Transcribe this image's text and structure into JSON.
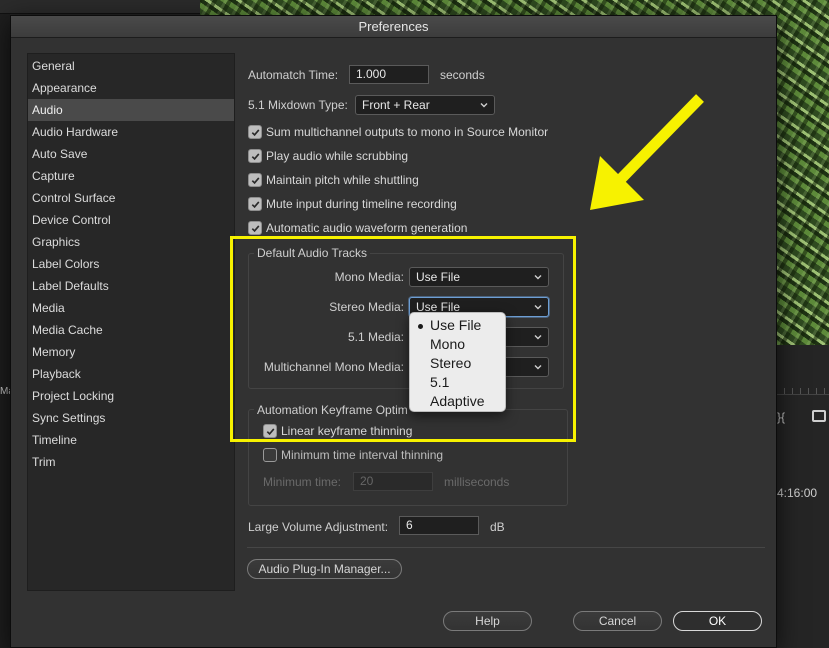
{
  "dialog": {
    "title": "Preferences"
  },
  "sidebar": {
    "items": [
      {
        "label": "General"
      },
      {
        "label": "Appearance"
      },
      {
        "label": "Audio",
        "selected": true
      },
      {
        "label": "Audio Hardware"
      },
      {
        "label": "Auto Save"
      },
      {
        "label": "Capture"
      },
      {
        "label": "Control Surface"
      },
      {
        "label": "Device Control"
      },
      {
        "label": "Graphics"
      },
      {
        "label": "Label Colors"
      },
      {
        "label": "Label Defaults"
      },
      {
        "label": "Media"
      },
      {
        "label": "Media Cache"
      },
      {
        "label": "Memory"
      },
      {
        "label": "Playback"
      },
      {
        "label": "Project Locking"
      },
      {
        "label": "Sync Settings"
      },
      {
        "label": "Timeline"
      },
      {
        "label": "Trim"
      }
    ]
  },
  "audio": {
    "automatch_label": "Automatch Time:",
    "automatch_value": "1.000",
    "automatch_unit": "seconds",
    "mixdown_label": "5.1 Mixdown Type:",
    "mixdown_value": "Front + Rear",
    "checkboxes": [
      {
        "label": "Sum multichannel outputs to mono in Source Monitor",
        "checked": true
      },
      {
        "label": "Play audio while scrubbing",
        "checked": true
      },
      {
        "label": "Maintain pitch while shuttling",
        "checked": true
      },
      {
        "label": "Mute input during timeline recording",
        "checked": true
      },
      {
        "label": "Automatic audio waveform generation",
        "checked": true
      }
    ]
  },
  "default_tracks": {
    "title": "Default Audio Tracks",
    "mono_label": "Mono Media:",
    "mono_value": "Use File",
    "stereo_label": "Stereo Media:",
    "stereo_value": "Use File",
    "fiveone_label": "5.1 Media:",
    "multichannel_label": "Multichannel Mono Media:"
  },
  "dropdown": {
    "options": [
      "Use File",
      "Mono",
      "Stereo",
      "5.1",
      "Adaptive"
    ],
    "selected": "Use File"
  },
  "keyframe": {
    "title": "Automation Keyframe Optim",
    "linear_label": "Linear keyframe thinning",
    "linear_checked": true,
    "min_interval_label": "Minimum time interval thinning",
    "min_interval_checked": false,
    "min_time_label": "Minimum time:",
    "min_time_value": "20",
    "min_time_unit": "milliseconds"
  },
  "volume": {
    "label": "Large Volume Adjustment:",
    "value": "6",
    "unit": "dB"
  },
  "buttons": {
    "plugin_manager": "Audio Plug-In Manager...",
    "help": "Help",
    "cancel": "Cancel",
    "ok": "OK"
  },
  "background": {
    "timecode": "4:16:00",
    "panel_label": "Ma"
  },
  "colors": {
    "highlight": "#f7f200",
    "focus_ring": "#6d9ed4",
    "dialog_bg": "#323232"
  }
}
